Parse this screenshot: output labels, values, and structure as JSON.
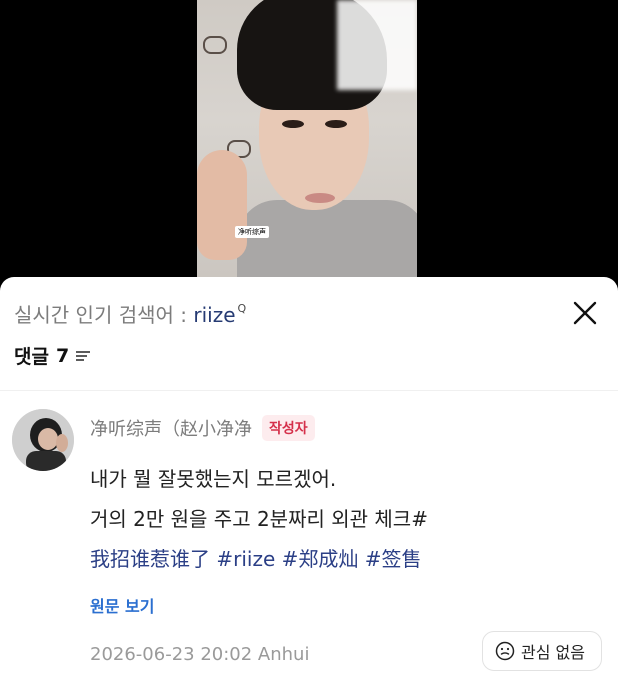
{
  "video": {
    "sticker_text": "净听综声"
  },
  "sheet": {
    "search_label": "실시간 인기 검색어 : ",
    "search_keyword": "riize",
    "search_mark": "Q",
    "comments_label": "댓글",
    "comments_count": "7"
  },
  "comment": {
    "author": "净听综声（赵小净净",
    "author_badge": "작성자",
    "lines": [
      "내가 뭘 잘못했는지 모르겠어.",
      "거의 2만 원을 주고 2분짜리 외관 체크#",
      "我招谁惹谁了 #riize #郑成灿 #签售"
    ],
    "view_original": "원문 보기",
    "timestamp_location": "2026-06-23 20:02 Anhui",
    "not_interested": "관심 없음"
  },
  "colors": {
    "keyword": "#263b73",
    "hashtag": "#2b3f86",
    "badge_text": "#d5304b",
    "badge_bg": "#fdecee",
    "link": "#2b6fd0"
  },
  "icons": {
    "close": "close-icon",
    "sort": "sort-icon",
    "not_interested": "neutral-face-icon"
  }
}
